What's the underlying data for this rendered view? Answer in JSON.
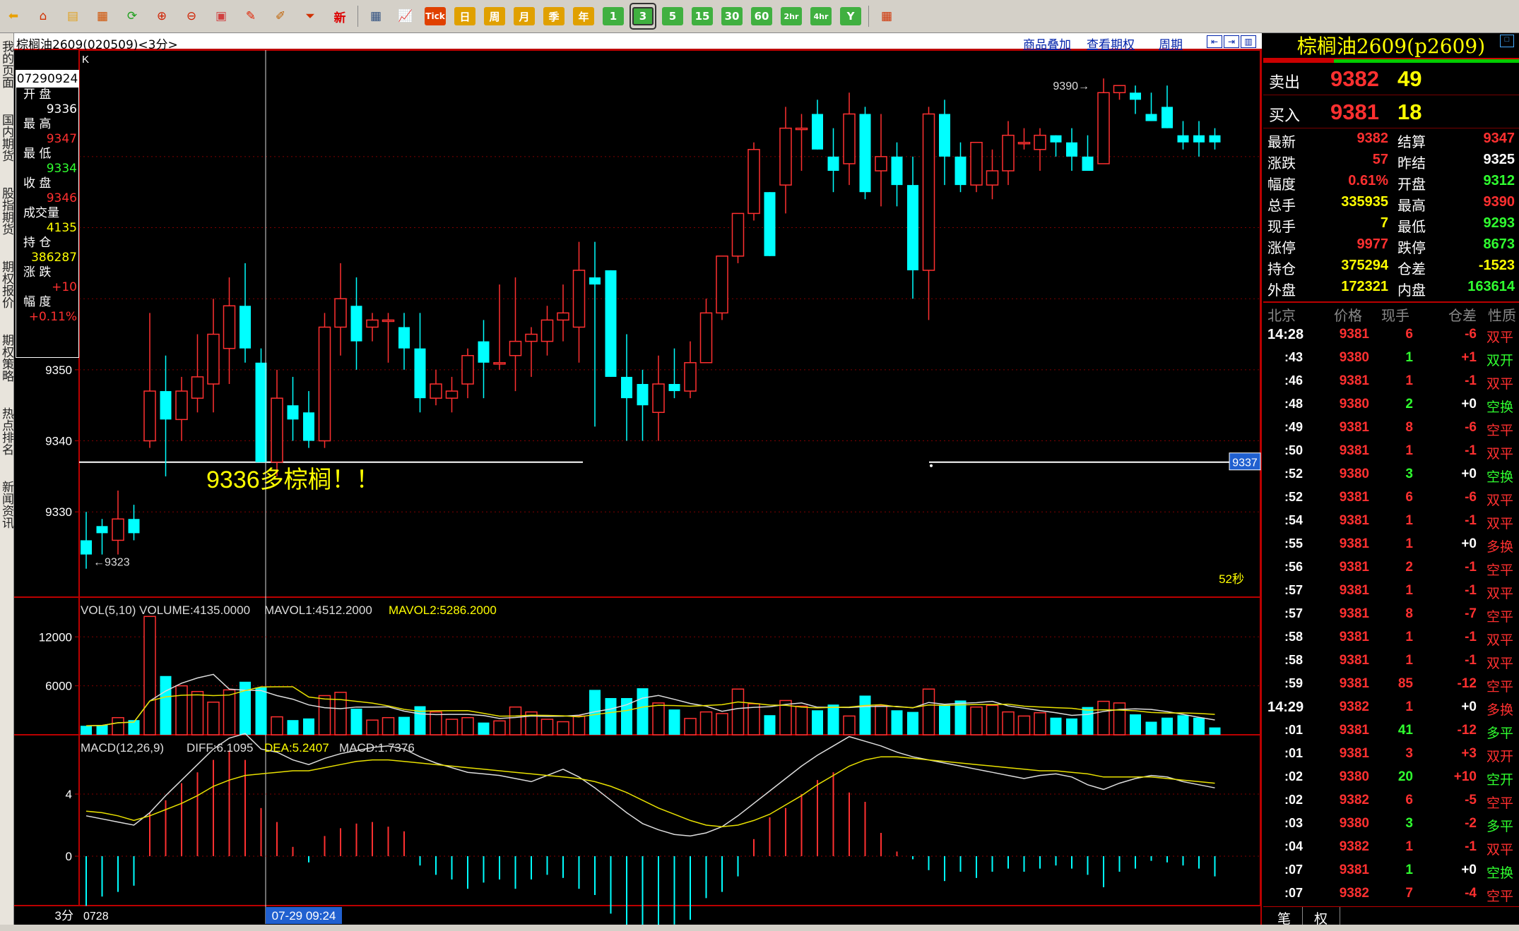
{
  "toolbar": {
    "icons": [
      "back-arrow-icon",
      "home-icon",
      "note-icon",
      "folder-icon",
      "refresh-icon",
      "zoom-in-icon",
      "zoom-out-icon",
      "window-icon",
      "pen-icon",
      "brush-icon",
      "funnel-icon",
      "new-icon",
      "table-icon",
      "chart-icon"
    ],
    "new_label": "新",
    "tick_label": "Tick",
    "periods": [
      "日",
      "周",
      "月",
      "季",
      "年"
    ],
    "minutes": [
      "1",
      "3",
      "5",
      "15",
      "30",
      "60",
      "2hr",
      "4hr",
      "Y"
    ],
    "selected_minute": "3"
  },
  "side_tabs": [
    "我的页面",
    "国内期货",
    "股指期货",
    "期权报价",
    "期权策略",
    "热点排名",
    "新闻资讯"
  ],
  "chart_header": {
    "title": "棕榈油2609(020509)<3分>",
    "links": [
      "商品叠加",
      "查看期权",
      "周期"
    ]
  },
  "info_box": {
    "date": "07290924",
    "rows": [
      {
        "label": "开 盘",
        "value": "9336",
        "color": "#ffffff"
      },
      {
        "label": "最 高",
        "value": "9347",
        "color": "#ff3030"
      },
      {
        "label": "最 低",
        "value": "9334",
        "color": "#30ff30"
      },
      {
        "label": "收 盘",
        "value": "9346",
        "color": "#ff3030"
      },
      {
        "label": "成交量",
        "value": "4135",
        "color": "#ffff00"
      },
      {
        "label": "持 仓",
        "value": "386287",
        "color": "#ffff00"
      },
      {
        "label": "涨 跌",
        "value": "+10",
        "color": "#ff3030"
      },
      {
        "label": "幅 度",
        "value": "+0.11%",
        "color": "#ff3030"
      }
    ]
  },
  "main_chart": {
    "k_label": "K",
    "price_ticks": [
      "9350",
      "9340",
      "9330"
    ],
    "high_marker": "9390→",
    "low_marker": "←9323",
    "annotation": "9336多棕榈！！",
    "hline_label": "9337",
    "countdown": "52秒"
  },
  "volume_panel": {
    "legend_vol": "VOL(5,10) VOLUME:4135.0000",
    "legend_m1": "MAVOL1:4512.2000",
    "legend_m2": "MAVOL2:5286.2000",
    "ticks": [
      "12000",
      "6000"
    ]
  },
  "macd_panel": {
    "legend_name": "MACD(12,26,9)",
    "legend_diff": "DIFF:6.1095",
    "legend_dea": "DEA:5.2407",
    "legend_macd": "MACD:1.7376",
    "ticks": [
      "4",
      "0"
    ]
  },
  "x_axis": {
    "period": "3分",
    "date": "0728",
    "cursor": "07-29 09:24"
  },
  "colors": {
    "up": "#ff3030",
    "down": "#00ffff",
    "yellow": "#ffff00",
    "grid": "#800000"
  },
  "chart_data": {
    "type": "candlestick",
    "y_range": [
      9318,
      9393
    ],
    "candles": [
      [
        9326,
        9330,
        9322,
        9324
      ],
      [
        9328,
        9329,
        9324,
        9327
      ],
      [
        9326,
        9333,
        9324,
        9329
      ],
      [
        9329,
        9331,
        9326,
        9327
      ],
      [
        9340,
        9358,
        9339,
        9347
      ],
      [
        9347,
        9352,
        9335,
        9343
      ],
      [
        9343,
        9349,
        9340,
        9347
      ],
      [
        9346,
        9355,
        9344,
        9349
      ],
      [
        9348,
        9360,
        9344,
        9355
      ],
      [
        9353,
        9363,
        9348,
        9359
      ],
      [
        9359,
        9365,
        9351,
        9353
      ],
      [
        9351,
        9353,
        9337,
        9337
      ],
      [
        9337,
        9350,
        9335,
        9346
      ],
      [
        9345,
        9349,
        9340,
        9343
      ],
      [
        9344,
        9347,
        9339,
        9340
      ],
      [
        9340,
        9358,
        9339,
        9356
      ],
      [
        9356,
        9365,
        9352,
        9360
      ],
      [
        9359,
        9363,
        9350,
        9354
      ],
      [
        9356,
        9358,
        9354,
        9357
      ],
      [
        9357,
        9358,
        9351,
        9357
      ],
      [
        9356,
        9358,
        9350,
        9353
      ],
      [
        9353,
        9358,
        9344,
        9346
      ],
      [
        9346,
        9350,
        9345,
        9348
      ],
      [
        9346,
        9349,
        9344,
        9347
      ],
      [
        9348,
        9353,
        9346,
        9352
      ],
      [
        9354,
        9357,
        9346,
        9351
      ],
      [
        9351,
        9362,
        9350,
        9351
      ],
      [
        9352,
        9363,
        9347,
        9354
      ],
      [
        9354,
        9356,
        9349,
        9355
      ],
      [
        9354,
        9359,
        9352,
        9357
      ],
      [
        9357,
        9362,
        9354,
        9358
      ],
      [
        9356,
        9368,
        9351,
        9364
      ],
      [
        9363,
        9368,
        9342,
        9362
      ],
      [
        9364,
        9364,
        9349,
        9349
      ],
      [
        9349,
        9355,
        9340,
        9346
      ],
      [
        9348,
        9350,
        9340,
        9345
      ],
      [
        9344,
        9352,
        9340,
        9348
      ],
      [
        9348,
        9353,
        9346,
        9347
      ],
      [
        9347,
        9354,
        9346,
        9351
      ],
      [
        9351,
        9360,
        9351,
        9358
      ],
      [
        9358,
        9365,
        9357,
        9366
      ],
      [
        9366,
        9369,
        9365,
        9372
      ],
      [
        9372,
        9382,
        9371,
        9381
      ],
      [
        9375,
        9375,
        9366,
        9366
      ],
      [
        9376,
        9387,
        9372,
        9384
      ],
      [
        9384,
        9386,
        9378,
        9384
      ],
      [
        9386,
        9388,
        9381,
        9381
      ],
      [
        9380,
        9384,
        9375,
        9378
      ],
      [
        9379,
        9389,
        9376,
        9386
      ],
      [
        9386,
        9387,
        9374,
        9375
      ],
      [
        9378,
        9386,
        9373,
        9380
      ],
      [
        9380,
        9382,
        9373,
        9376
      ],
      [
        9376,
        9380,
        9360,
        9364
      ],
      [
        9364,
        9387,
        9357,
        9386
      ],
      [
        9386,
        9388,
        9376,
        9380
      ],
      [
        9380,
        9382,
        9375,
        9376
      ],
      [
        9376,
        9382,
        9375,
        9382
      ],
      [
        9376,
        9381,
        9374,
        9378
      ],
      [
        9378,
        9385,
        9376,
        9383
      ],
      [
        9382,
        9384,
        9381,
        9382
      ],
      [
        9381,
        9384,
        9378,
        9383
      ],
      [
        9383,
        9383,
        9380,
        9382
      ],
      [
        9382,
        9384,
        9378,
        9380
      ],
      [
        9380,
        9383,
        9378,
        9378
      ],
      [
        9379,
        9391,
        9379,
        9389
      ],
      [
        9389,
        9390,
        9388,
        9390
      ],
      [
        9389,
        9390,
        9386,
        9388
      ],
      [
        9386,
        9389,
        9385,
        9385
      ],
      [
        9387,
        9390,
        9384,
        9384
      ],
      [
        9383,
        9385,
        9381,
        9382
      ],
      [
        9383,
        9385,
        9380,
        9382
      ],
      [
        9383,
        9384,
        9381,
        9382
      ]
    ],
    "volumes": [
      1100,
      1200,
      2100,
      1800,
      14500,
      7200,
      6000,
      5300,
      4000,
      5500,
      6500,
      5800,
      2200,
      1800,
      2000,
      4800,
      5200,
      3200,
      1800,
      2100,
      2200,
      3500,
      2800,
      1900,
      2100,
      1500,
      1700,
      3400,
      2800,
      1900,
      1600,
      2300,
      5500,
      4500,
      4500,
      5700,
      3900,
      3100,
      2000,
      2800,
      2600,
      5600,
      3800,
      2400,
      4200,
      3500,
      3000,
      3700,
      2300,
      4800,
      3600,
      3000,
      2800,
      5600,
      3700,
      4200,
      3400,
      3600,
      2800,
      2300,
      2700,
      2100,
      2000,
      3400,
      4100,
      3900,
      2500,
      1600,
      2100,
      2400,
      2100,
      900
    ],
    "macd_hist": [
      -3.2,
      -2.6,
      -2.3,
      -1.9,
      2.8,
      3.6,
      4.7,
      5.4,
      6.2,
      6.8,
      6.2,
      3.1,
      2.2,
      0.6,
      -0.4,
      1.3,
      1.8,
      2.1,
      2.2,
      1.9,
      1.6,
      -0.6,
      -1.2,
      -1.5,
      -2.1,
      -1.7,
      -1.5,
      -2.1,
      -1.5,
      -1.2,
      -1.4,
      -2.1,
      -2.5,
      -3.7,
      -5.7,
      -5.8,
      -5.8,
      -4.4,
      -4.1,
      -2.7,
      -2.3,
      -1.3,
      1.1,
      2.5,
      3.1,
      4.0,
      4.9,
      5.4,
      4.1,
      3.5,
      1.5,
      0.3,
      -0.2,
      -0.9,
      -1.6,
      -1.0,
      -1.4,
      -1.0,
      -0.8,
      -1.0,
      -0.8,
      -0.6,
      -0.8,
      -1.2,
      -2.0,
      -1.0,
      -0.8,
      -0.3,
      -0.4,
      -0.6,
      -0.8,
      -1.3
    ],
    "macd_diff": [
      2.6,
      2.4,
      2.2,
      2.0,
      2.8,
      3.9,
      4.9,
      5.9,
      6.9,
      7.6,
      7.9,
      6.9,
      6.7,
      6.2,
      5.9,
      6.3,
      6.6,
      6.8,
      7.0,
      7.1,
      6.9,
      6.4,
      6.0,
      5.7,
      5.4,
      5.3,
      5.2,
      5.0,
      4.8,
      5.2,
      5.6,
      5.1,
      4.4,
      3.6,
      2.8,
      2.1,
      1.7,
      1.4,
      1.3,
      1.5,
      1.9,
      2.6,
      3.4,
      4.2,
      5.0,
      5.8,
      6.5,
      7.1,
      7.7,
      7.4,
      7.1,
      6.7,
      6.4,
      6.2,
      6.0,
      5.8,
      5.6,
      5.4,
      5.2,
      5.0,
      5.2,
      5.3,
      5.1,
      4.6,
      4.3,
      4.7,
      5.0,
      5.2,
      5.1,
      4.8,
      4.6,
      4.4
    ],
    "macd_dea": [
      2.9,
      2.8,
      2.6,
      2.3,
      2.6,
      3.0,
      3.4,
      3.9,
      4.5,
      4.9,
      5.2,
      5.3,
      5.4,
      5.5,
      5.5,
      5.7,
      5.9,
      6.1,
      6.2,
      6.2,
      6.1,
      6.0,
      5.9,
      5.8,
      5.7,
      5.6,
      5.5,
      5.4,
      5.3,
      5.2,
      5.1,
      5.0,
      4.8,
      4.5,
      4.1,
      3.6,
      3.1,
      2.7,
      2.3,
      2.0,
      1.9,
      2.0,
      2.3,
      2.7,
      3.3,
      3.9,
      4.6,
      5.2,
      5.8,
      6.2,
      6.4,
      6.4,
      6.3,
      6.2,
      6.1,
      6.0,
      5.9,
      5.8,
      5.7,
      5.6,
      5.5,
      5.5,
      5.4,
      5.3,
      5.1,
      5.1,
      5.1,
      5.1,
      5.0,
      4.9,
      4.8,
      4.7
    ]
  },
  "right_panel": {
    "title": "棕榈油2609(p2609)",
    "sell": {
      "label": "卖出",
      "price": "9382",
      "volume": "49"
    },
    "buy": {
      "label": "买入",
      "price": "9381",
      "volume": "18"
    },
    "stats": [
      {
        "l1": "最新",
        "v1": "9382",
        "c1": "#ff3030",
        "l2": "结算",
        "v2": "9347",
        "c2": "#ff3030"
      },
      {
        "l1": "涨跌",
        "v1": "57",
        "c1": "#ff3030",
        "l2": "昨结",
        "v2": "9325",
        "c2": "#ffffff"
      },
      {
        "l1": "幅度",
        "v1": "0.61%",
        "c1": "#ff3030",
        "l2": "开盘",
        "v2": "9312",
        "c2": "#30ff30"
      },
      {
        "l1": "总手",
        "v1": "335935",
        "c1": "#ffff00",
        "l2": "最高",
        "v2": "9390",
        "c2": "#ff3030"
      },
      {
        "l1": "现手",
        "v1": "7",
        "c1": "#ffff00",
        "l2": "最低",
        "v2": "9293",
        "c2": "#30ff30"
      },
      {
        "l1": "涨停",
        "v1": "9977",
        "c1": "#ff3030",
        "l2": "跌停",
        "v2": "8673",
        "c2": "#30ff30"
      },
      {
        "l1": "持仓",
        "v1": "375294",
        "c1": "#ffff00",
        "l2": "仓差",
        "v2": "-1523",
        "c2": "#ffff00"
      },
      {
        "l1": "外盘",
        "v1": "172321",
        "c1": "#ffff00",
        "l2": "内盘",
        "v2": "163614",
        "c2": "#30ff30"
      }
    ],
    "ticks_header": [
      "北京",
      "价格",
      "现手",
      "仓差",
      "性质"
    ],
    "ticks": [
      {
        "t": "14:28",
        "p": "9381",
        "v": "6",
        "oi": "-6",
        "n": "双平",
        "nc": "#ff3030",
        "bold": true
      },
      {
        "t": ":43",
        "p": "9380",
        "v": "1",
        "oi": "+1",
        "n": "双开",
        "nc": "#30ff30"
      },
      {
        "t": ":46",
        "p": "9381",
        "v": "1",
        "oi": "-1",
        "n": "双平",
        "nc": "#ff3030"
      },
      {
        "t": ":48",
        "p": "9380",
        "v": "2",
        "oi": "+0",
        "n": "空换",
        "nc": "#30ff30"
      },
      {
        "t": ":49",
        "p": "9381",
        "v": "8",
        "oi": "-6",
        "n": "空平",
        "nc": "#ff3030"
      },
      {
        "t": ":50",
        "p": "9381",
        "v": "1",
        "oi": "-1",
        "n": "双平",
        "nc": "#ff3030"
      },
      {
        "t": ":52",
        "p": "9380",
        "v": "3",
        "oi": "+0",
        "n": "空换",
        "nc": "#30ff30"
      },
      {
        "t": ":52",
        "p": "9381",
        "v": "6",
        "oi": "-6",
        "n": "双平",
        "nc": "#ff3030"
      },
      {
        "t": ":54",
        "p": "9381",
        "v": "1",
        "oi": "-1",
        "n": "双平",
        "nc": "#ff3030"
      },
      {
        "t": ":55",
        "p": "9381",
        "v": "1",
        "oi": "+0",
        "n": "多换",
        "nc": "#ff3030"
      },
      {
        "t": ":56",
        "p": "9381",
        "v": "2",
        "oi": "-1",
        "n": "空平",
        "nc": "#ff3030"
      },
      {
        "t": ":57",
        "p": "9381",
        "v": "1",
        "oi": "-1",
        "n": "双平",
        "nc": "#ff3030"
      },
      {
        "t": ":57",
        "p": "9381",
        "v": "8",
        "oi": "-7",
        "n": "空平",
        "nc": "#ff3030"
      },
      {
        "t": ":58",
        "p": "9381",
        "v": "1",
        "oi": "-1",
        "n": "双平",
        "nc": "#ff3030"
      },
      {
        "t": ":58",
        "p": "9381",
        "v": "1",
        "oi": "-1",
        "n": "双平",
        "nc": "#ff3030"
      },
      {
        "t": ":59",
        "p": "9381",
        "v": "85",
        "oi": "-12",
        "n": "空平",
        "nc": "#ff3030"
      },
      {
        "t": "14:29",
        "p": "9382",
        "v": "1",
        "oi": "+0",
        "n": "多换",
        "nc": "#ff3030",
        "bold": true
      },
      {
        "t": ":01",
        "p": "9381",
        "v": "41",
        "oi": "-12",
        "n": "多平",
        "nc": "#30ff30"
      },
      {
        "t": ":01",
        "p": "9381",
        "v": "3",
        "oi": "+3",
        "n": "双开",
        "nc": "#ff3030"
      },
      {
        "t": ":02",
        "p": "9380",
        "v": "20",
        "oi": "+10",
        "n": "空开",
        "nc": "#30ff30"
      },
      {
        "t": ":02",
        "p": "9382",
        "v": "6",
        "oi": "-5",
        "n": "空平",
        "nc": "#ff3030"
      },
      {
        "t": ":03",
        "p": "9380",
        "v": "3",
        "oi": "-2",
        "n": "多平",
        "nc": "#30ff30"
      },
      {
        "t": ":04",
        "p": "9382",
        "v": "1",
        "oi": "-1",
        "n": "双平",
        "nc": "#ff3030"
      },
      {
        "t": ":07",
        "p": "9381",
        "v": "1",
        "oi": "+0",
        "n": "空换",
        "nc": "#30ff30"
      },
      {
        "t": ":07",
        "p": "9382",
        "v": "7",
        "oi": "-4",
        "n": "空平",
        "nc": "#ff3030"
      }
    ],
    "bottom_tabs": [
      "笔",
      "权"
    ]
  }
}
